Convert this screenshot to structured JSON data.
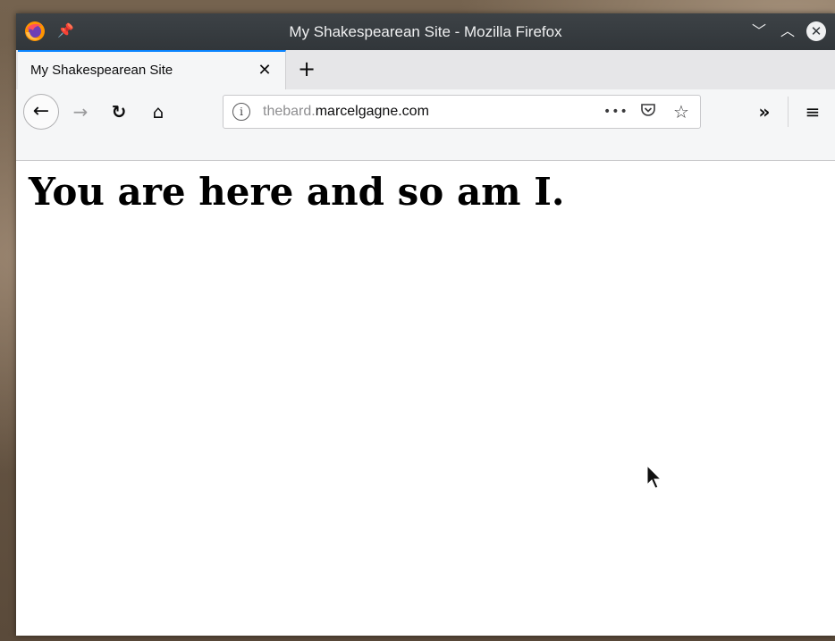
{
  "window": {
    "title": "My Shakespearean Site - Mozilla Firefox",
    "icons": {
      "app": "firefox-icon",
      "pin": "pin-icon",
      "minimize": "chevron-down-icon",
      "maximize": "chevron-up-icon",
      "close": "close-circle-icon"
    }
  },
  "tabs": [
    {
      "label": "My Shakespearean Site",
      "close_icon": "close-icon"
    }
  ],
  "new_tab_icon": "plus-icon",
  "navbar": {
    "back_icon": "arrow-left-icon",
    "forward_icon": "arrow-right-icon",
    "reload_icon": "reload-icon",
    "home_icon": "home-icon",
    "url_subdomain": "thebard.",
    "url_domain": "marcelgagne.com",
    "page_actions_icon": "ellipsis-icon",
    "pocket_icon": "pocket-icon",
    "bookmark_icon": "star-icon",
    "overflow_icon": "double-chevron-right-icon",
    "menu_icon": "hamburger-menu-icon"
  },
  "page": {
    "heading": "You are here and so am I."
  },
  "colors": {
    "accent": "#0a84ff",
    "titlebar": "#31363a",
    "toolbar": "#f5f6f7"
  }
}
